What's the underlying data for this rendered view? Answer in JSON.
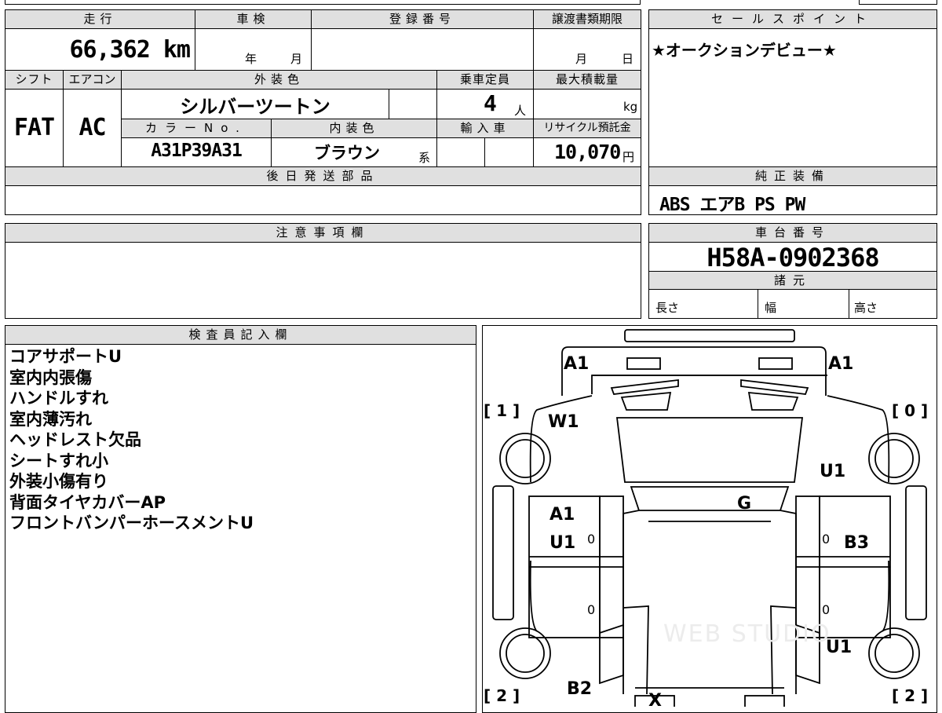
{
  "labels": {
    "mileage": "走行",
    "inspection": "車検",
    "registration": "登録番号",
    "transfer_deadline": "譲渡書類期限",
    "sales_point": "セールスポイント",
    "shift": "シフト",
    "aircon": "エアコン",
    "exterior_color": "外装色",
    "capacity": "乗車定員",
    "max_load": "最大積載量",
    "color_no": "カラーNo.",
    "interior_color": "内装色",
    "import": "輸入車",
    "recycle_fee": "リサイクル預託金",
    "later_parts": "後日発送部品",
    "factory_equipment": "純正装備",
    "notes": "注意事項欄",
    "chassis_no": "車台番号",
    "specs": "諸元",
    "length": "長さ",
    "width": "幅",
    "height": "高さ",
    "inspector_notes": "検査員記入欄",
    "year_unit": "年",
    "month_unit": "月",
    "day_unit": "日",
    "person_unit": "人",
    "kg_unit": "kg",
    "yen_unit": "円",
    "color_suffix": "系"
  },
  "vehicle": {
    "mileage": "66,362 km",
    "shift": "FAT",
    "aircon": "AC",
    "exterior_color": "シルバーツートン",
    "capacity": "4",
    "color_no": "A31P39A31",
    "interior_color": "ブラウン",
    "recycle_fee": "10,070",
    "sales_point": "★オークションデビュー★",
    "equipment": "ABS エアB PS PW",
    "chassis_no": "H58A-0902368"
  },
  "inspector_notes": [
    "コアサポートU",
    "室内内張傷",
    "ハンドルすれ",
    "室内薄汚れ",
    "ヘッドレスト欠品",
    "シートすれ小",
    "外装小傷有り",
    "背面タイヤカバーAP",
    "フロントバンパーホースメントU"
  ],
  "diagram": {
    "marks": {
      "front_left": "A1",
      "front_right": "A1",
      "fender_left": "W1",
      "fender_right": "U1",
      "roof": "G",
      "front_door_left_1": "A1",
      "front_door_left_2": "U1",
      "front_door_right": "B3",
      "rear_fender_right": "U1",
      "rear_left": "B2",
      "rear_center": "X"
    },
    "zeros": [
      "0",
      "0",
      "0",
      "0"
    ],
    "bracket_front_left": "[ 1 ]",
    "bracket_front_right": "[ 0 ]",
    "bracket_rear_left": "[ 2 ]",
    "bracket_rear_right": "[ 2 ]",
    "watermark": "WEB STUDIO"
  }
}
